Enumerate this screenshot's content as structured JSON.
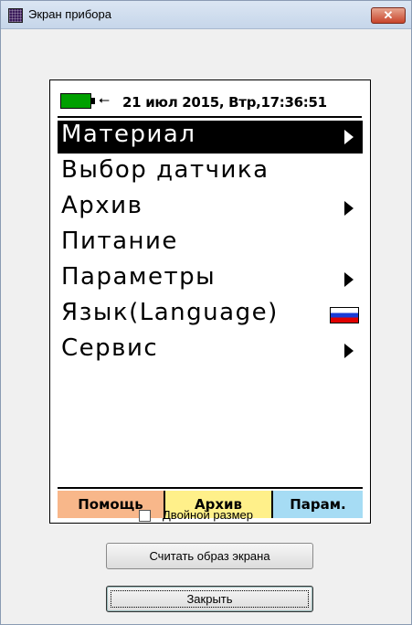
{
  "window": {
    "title": "Экран прибора",
    "close_symbol": "✕"
  },
  "device": {
    "status": {
      "battery_icon": "battery-icon",
      "usb_icon": "usb-icon",
      "usb_symbol": "⭠",
      "datetime": "21 июл 2015, Втр,17:36:51"
    },
    "menu": [
      {
        "label": "Материал",
        "selected": true,
        "arrow": true
      },
      {
        "label": "Выбор датчика",
        "selected": false,
        "arrow": false
      },
      {
        "label": "Архив",
        "selected": false,
        "arrow": true
      },
      {
        "label": "Питание",
        "selected": false,
        "arrow": false
      },
      {
        "label": "Параметры",
        "selected": false,
        "arrow": true
      },
      {
        "label": "Язык(Language)",
        "selected": false,
        "flag": "russian-flag-icon"
      },
      {
        "label": "Сервис",
        "selected": false,
        "arrow": true
      }
    ],
    "softkeys": {
      "help": "Помощь",
      "archive": "Архив",
      "params": "Парам."
    }
  },
  "controls": {
    "double_size_label": "Двойной размер",
    "double_size_checked": false,
    "read_screen_label": "Считать образ экрана",
    "close_label": "Закрыть"
  },
  "colors": {
    "battery": "#00a000",
    "help_key": "#f8b78a",
    "archive_key": "#fff08a",
    "params_key": "#a6dcf4"
  }
}
